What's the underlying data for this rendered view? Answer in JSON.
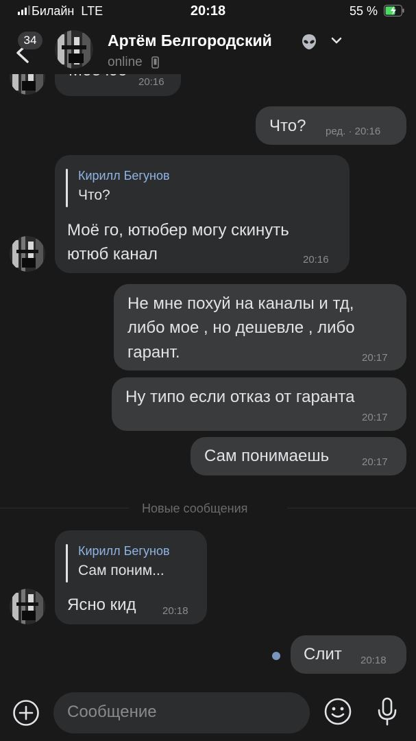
{
  "status_bar": {
    "carrier": "Билайн",
    "network": "LTE",
    "time": "20:18",
    "battery": "55 %"
  },
  "header": {
    "unread_badge": "34",
    "contact_name": "Артём Белгородский",
    "contact_status": "online",
    "icons": [
      "back-arrow-icon",
      "alien-emoji-icon",
      "chevron-down-icon",
      "mobile-phone-icon"
    ]
  },
  "messages": [
    {
      "direction": "in",
      "text": "Моё юб",
      "time": "20:16",
      "partially_visible": true
    },
    {
      "direction": "out",
      "text": "Что?",
      "edited": "ред.",
      "time": "20:16"
    },
    {
      "direction": "in",
      "reply_to": {
        "name": "Кирилл Бегунов",
        "text": "Что?"
      },
      "text_lines": [
        "Моё го, ютюбер могу скинуть",
        "ютюб канал"
      ],
      "time": "20:16"
    },
    {
      "direction": "out",
      "text_lines": [
        "Не мне похуй на каналы и тд,",
        "либо мое , но дешевле , либо",
        "гарант."
      ],
      "time": "20:17"
    },
    {
      "direction": "out",
      "text": "Ну типо если отказ от гаранта",
      "time": "20:17"
    },
    {
      "direction": "out",
      "text": "Сам понимаешь",
      "time": "20:17"
    },
    {
      "direction": "in",
      "reply_to": {
        "name": "Кирилл Бегунов",
        "text": "Сам поним..."
      },
      "text": "Ясно кид",
      "time": "20:18"
    },
    {
      "direction": "out",
      "text": "Слит",
      "time": "20:18",
      "unread_dot": true
    }
  ],
  "separator": "Новые сообщения",
  "composer": {
    "placeholder": "Сообщение",
    "icons": [
      "plus-icon",
      "emoji-icon",
      "microphone-icon"
    ]
  },
  "colors": {
    "background": "#19191a",
    "bubble_in": "#2c2d2e",
    "bubble_out": "#3a3b3c",
    "reply_name": "#8fb4e3",
    "battery_green": "#4cd964",
    "unread_dot": "#7895be"
  }
}
